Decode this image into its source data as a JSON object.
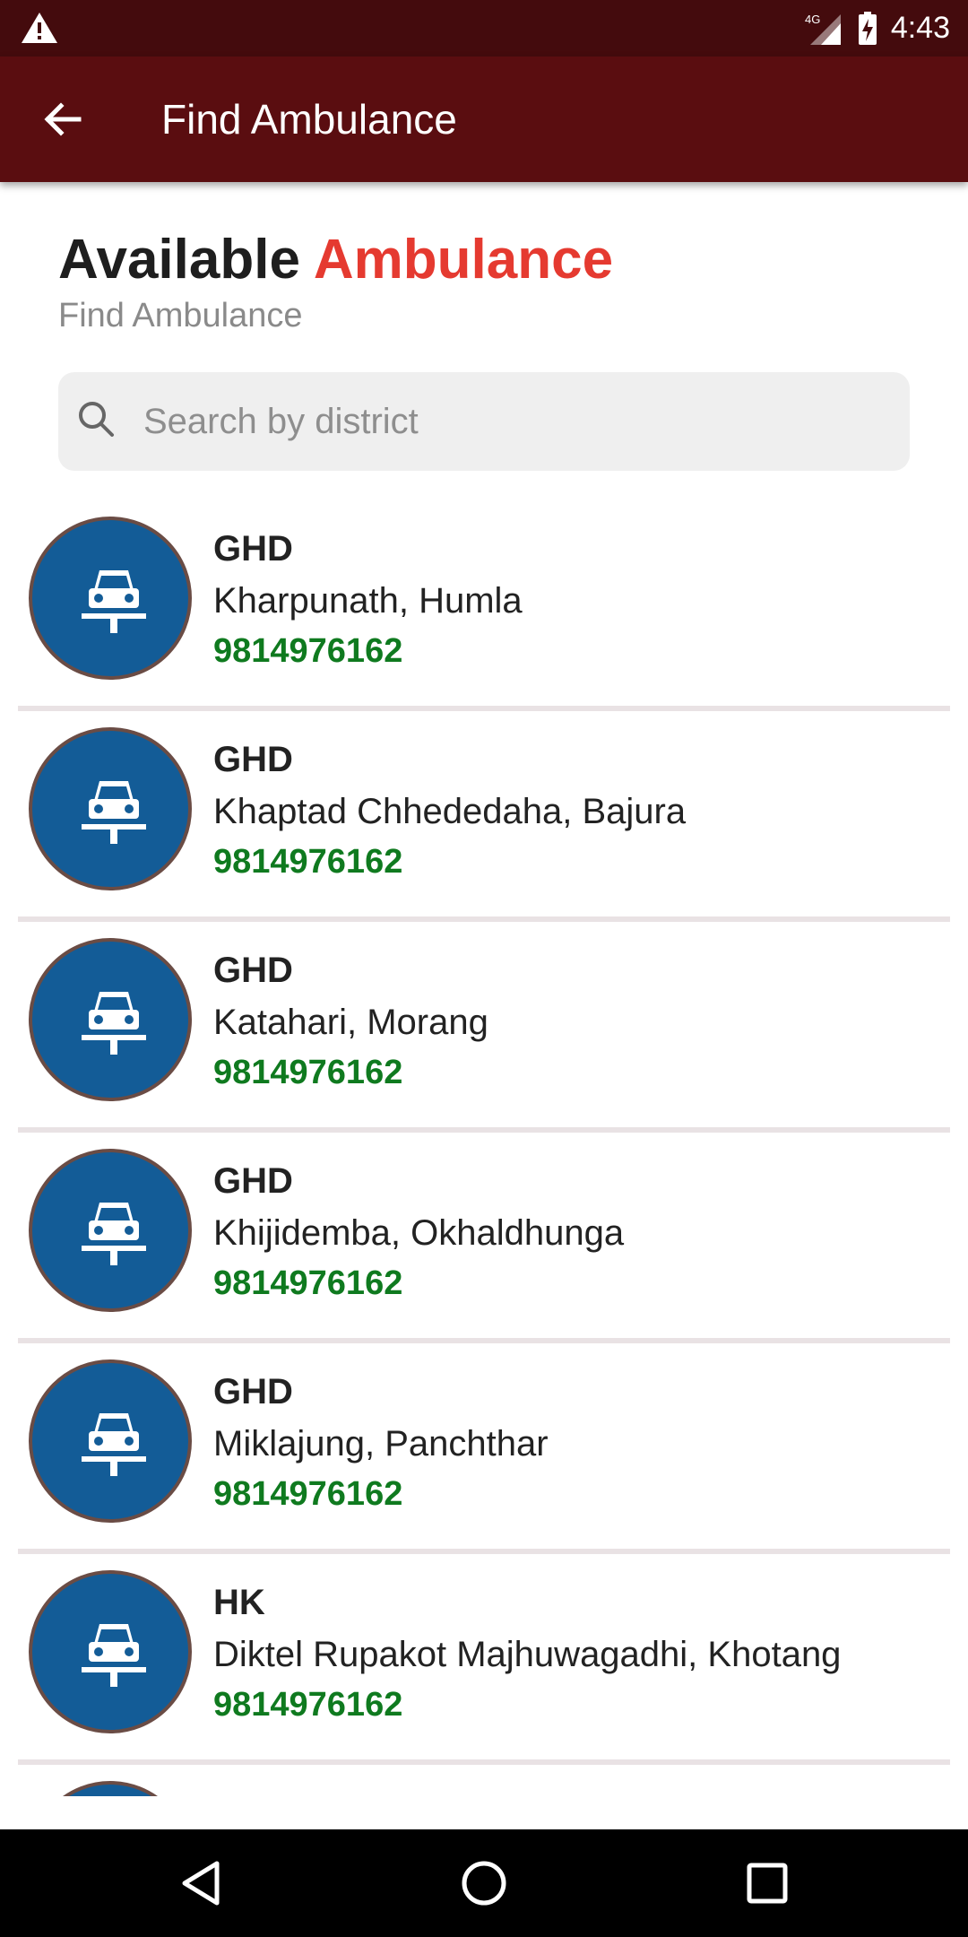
{
  "status_bar": {
    "time": "4:43",
    "network": "4G"
  },
  "app_bar": {
    "title": "Find Ambulance"
  },
  "header": {
    "title_main": "Available",
    "title_accent": "Ambulance",
    "subtitle": "Find Ambulance"
  },
  "search": {
    "placeholder": "Search by district",
    "value": ""
  },
  "ambulances": [
    {
      "name": "GHD",
      "location": "Kharpunath, Humla",
      "phone": "9814976162"
    },
    {
      "name": "GHD",
      "location": "Khaptad Chhededaha, Bajura",
      "phone": "9814976162"
    },
    {
      "name": "GHD",
      "location": "Katahari, Morang",
      "phone": "9814976162"
    },
    {
      "name": "GHD",
      "location": "Khijidemba, Okhaldhunga",
      "phone": "9814976162"
    },
    {
      "name": "GHD",
      "location": "Miklajung, Panchthar",
      "phone": "9814976162"
    },
    {
      "name": "HK",
      "location": "Diktel Rupakot Majhuwagadhi, Khotang",
      "phone": "9814976162"
    }
  ],
  "colors": {
    "app_bar": "#5a0d10",
    "status_bar": "#440b0d",
    "accent": "#e53a30",
    "avatar": "#135c97",
    "phone": "#0f7a1f"
  }
}
